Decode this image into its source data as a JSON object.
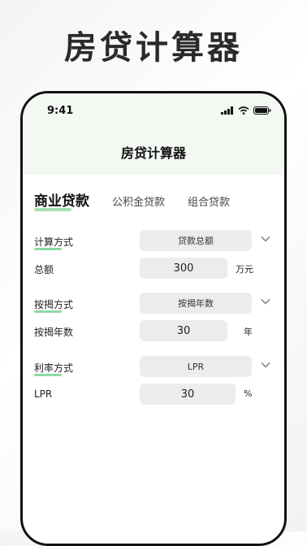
{
  "promo": {
    "title": "房贷计算器"
  },
  "status": {
    "time": "9:41"
  },
  "app": {
    "title": "房贷计算器"
  },
  "tabs": [
    {
      "label": "商业贷款",
      "active": true
    },
    {
      "label": "公积金贷款",
      "active": false
    },
    {
      "label": "组合贷款",
      "active": false
    }
  ],
  "form": {
    "calc_method": {
      "label": "计算方式",
      "value": "贷款总额"
    },
    "total": {
      "label": "总额",
      "value": "300",
      "unit": "万元"
    },
    "mortgage_method": {
      "label": "按揭方式",
      "value": "按揭年数"
    },
    "years": {
      "label": "按揭年数",
      "value": "30",
      "unit": "年"
    },
    "rate_method": {
      "label": "利率方式",
      "value": "LPR"
    },
    "lpr": {
      "label": "LPR",
      "value": "30",
      "unit": "%"
    }
  },
  "colors": {
    "accent": "#8fd8a3",
    "header_bg": "#f3f8f3",
    "field_bg": "#ececec"
  }
}
